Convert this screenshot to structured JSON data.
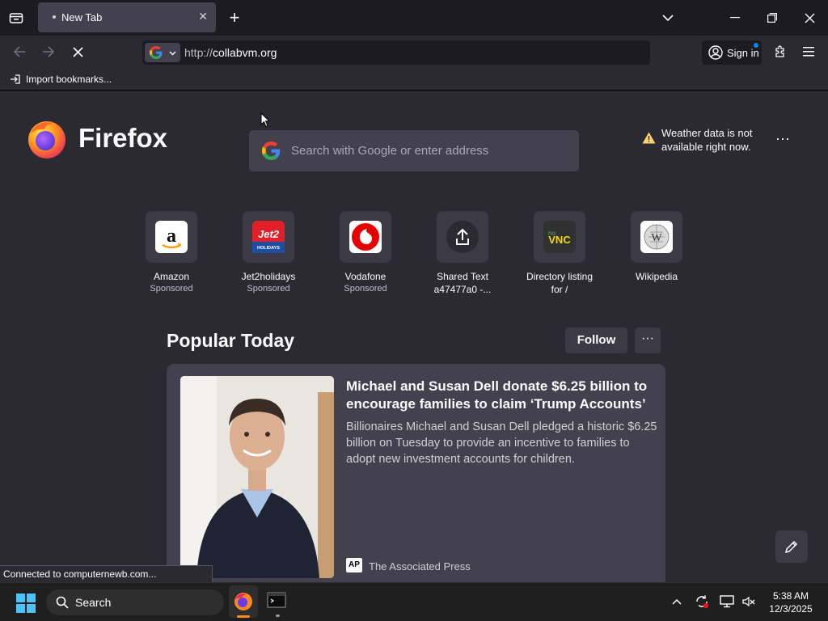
{
  "browser": {
    "tab": {
      "title": "New Tab"
    },
    "url": {
      "protocol": "http://",
      "host": "collabvm.org"
    },
    "account": {
      "sign_in_label": "Sign in"
    },
    "bookmarks": {
      "import_label": "Import bookmarks..."
    },
    "status_text": "Connected to computernewb.com..."
  },
  "newtab": {
    "brand_name": "Firefox",
    "search": {
      "placeholder": "Search with Google or enter address"
    },
    "weather": {
      "message": "Weather data is not available right now."
    },
    "shortcuts": [
      {
        "title": "Amazon",
        "subtitle": "Sponsored",
        "icon": "amazon-logo"
      },
      {
        "title": "Jet2holidays",
        "subtitle": "Sponsored",
        "icon": "jet2-logo"
      },
      {
        "title": "Vodafone",
        "subtitle": "Sponsored",
        "icon": "vodafone-logo"
      },
      {
        "title": "Shared Text",
        "subtitle": "a47477a0 -...",
        "icon": "share-icon"
      },
      {
        "title": "Directory listing",
        "subtitle": "for /",
        "icon": "novnc-logo"
      },
      {
        "title": "Wikipedia",
        "subtitle": "",
        "icon": "wikipedia-logo"
      }
    ],
    "section": {
      "title": "Popular Today",
      "follow_label": "Follow"
    },
    "story": {
      "headline": "Michael and Susan Dell donate $6.25 billion to encourage families to claim ‘Trump Accounts’",
      "summary": "Billionaires Michael and Susan Dell pledged a historic $6.25 billion on Tuesday to provide an incentive to families to adopt new investment accounts for children.",
      "source_logo": "AP",
      "source": "The Associated Press"
    }
  },
  "taskbar": {
    "search_label": "Search",
    "time": "5:38 AM",
    "date": "12/3/2025"
  },
  "colors": {
    "toolbar": "#2b2a33",
    "tabstrip": "#1c1b22",
    "card": "#42414d",
    "accent": "#0a84ff"
  }
}
